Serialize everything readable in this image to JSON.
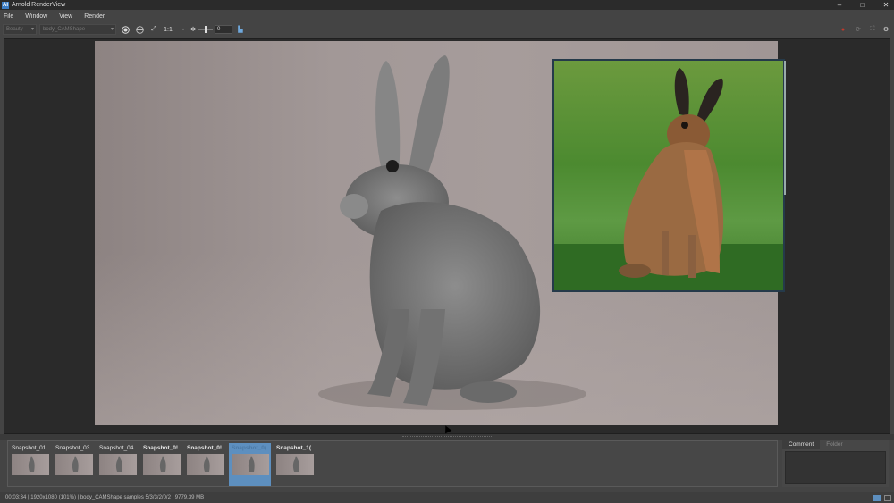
{
  "window": {
    "title": "Arnold RenderView",
    "icon_text": "AI"
  },
  "menu": [
    "File",
    "Window",
    "View",
    "Render"
  ],
  "toolbar": {
    "display_select": "Beauty",
    "camera_select": "body_CAMShape",
    "zoom_label": "1:1",
    "exposure_value": "0"
  },
  "snapshots": [
    {
      "label": "Snapshot_01",
      "bold": false,
      "selected": false
    },
    {
      "label": "Snapshot_03",
      "bold": false,
      "selected": false
    },
    {
      "label": "Snapshot_04",
      "bold": false,
      "selected": false
    },
    {
      "label": "Snapshot_0!",
      "bold": true,
      "selected": false
    },
    {
      "label": "Snapshot_0!",
      "bold": true,
      "selected": false
    },
    {
      "label": "Snapshot_0(",
      "bold": true,
      "selected": true
    },
    {
      "label": "Snapshot_1(",
      "bold": true,
      "selected": false
    }
  ],
  "side_panel": {
    "tab_comment": "Comment",
    "tab_folder": "Folder"
  },
  "status": "00:03:34 | 1920x1080 (101%) | body_CAMShape  samples 5/3/3/2/0/2 | 9779.39 MB"
}
